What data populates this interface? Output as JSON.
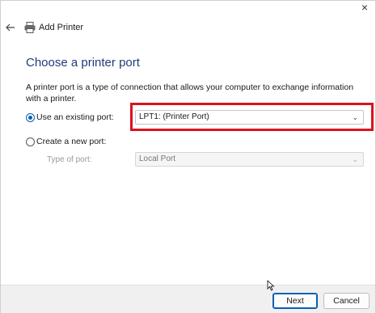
{
  "window": {
    "title": "Add Printer",
    "close_glyph": "×",
    "back_icon": "back-arrow-icon",
    "printer_icon": "printer-icon"
  },
  "page": {
    "heading": "Choose a printer port",
    "description": "A printer port is a type of connection that allows your computer to exchange information with a printer."
  },
  "options": {
    "existing_label": "Use an existing port:",
    "existing_selected": true,
    "existing_value": "LPT1: (Printer Port)",
    "new_label": "Create a new port:",
    "new_selected": false,
    "type_label": "Type of port:",
    "type_value": "Local Port"
  },
  "footer": {
    "next_label": "Next",
    "cancel_label": "Cancel"
  },
  "colors": {
    "accent": "#0a5fb4",
    "heading": "#1f3d7a",
    "highlight": "#d9121f"
  }
}
